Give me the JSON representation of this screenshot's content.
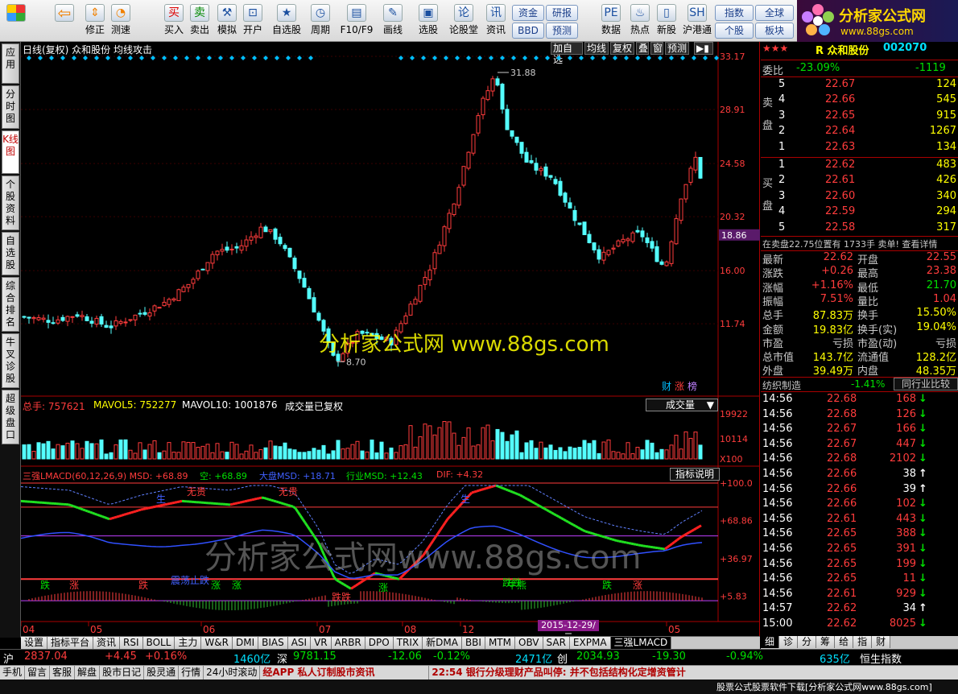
{
  "toolbar": {
    "buttons": [
      {
        "label": "",
        "icon": "windows-icon"
      },
      {
        "label": "",
        "icon": "back-arrow-icon"
      },
      {
        "label": "修正",
        "icon": "up-down-icon"
      },
      {
        "label": "测速",
        "icon": "speed-icon"
      },
      {
        "label": "买入",
        "icon": "buy-icon",
        "glyph": "买"
      },
      {
        "label": "卖出",
        "icon": "sell-icon",
        "glyph": "卖"
      },
      {
        "label": "模拟",
        "icon": "hammer-icon",
        "glyph": "⚒"
      },
      {
        "label": "开户",
        "icon": "lock-icon",
        "glyph": "⊡"
      },
      {
        "label": "自选股",
        "icon": "star-icon",
        "glyph": "★"
      },
      {
        "label": "周期",
        "icon": "clock-icon",
        "glyph": "◷"
      },
      {
        "label": "F10/F9",
        "icon": "f10-icon",
        "glyph": "▤"
      },
      {
        "label": "画线",
        "icon": "pen-icon",
        "glyph": "✎"
      },
      {
        "label": "选股",
        "icon": "select-icon",
        "glyph": "▣"
      },
      {
        "label": "论股堂",
        "icon": "forum-icon",
        "glyph": "论"
      },
      {
        "label": "资讯",
        "icon": "news-icon",
        "glyph": "讯"
      },
      {
        "label": "数据",
        "icon": "pe-icon",
        "glyph": "PE"
      },
      {
        "label": "热点",
        "icon": "hot-icon",
        "glyph": "♨"
      },
      {
        "label": "新股",
        "icon": "newstock-icon",
        "glyph": "▯"
      },
      {
        "label": "沪港通",
        "icon": "hk-icon",
        "glyph": "SH"
      }
    ],
    "small": [
      "资金",
      "研报",
      "BBD",
      "预测",
      "指数",
      "全球",
      "个股",
      "板块"
    ]
  },
  "logo": {
    "name": "分析家公式网",
    "url": "www.88gs.com"
  },
  "left_tabs": [
    "应用",
    "分时图",
    "K线图",
    "个股资料",
    "自选股",
    "综合排名",
    "牛叉诊股",
    "超级盘口"
  ],
  "chart": {
    "header": "日线(复权)  众和股份  均线攻击",
    "controls": [
      "加自选",
      "均线",
      "复权",
      "叠",
      "窗",
      "预测"
    ],
    "price_labels": [
      "33.17",
      "28.91",
      "24.58",
      "20.32",
      "16.00",
      "11.74"
    ],
    "cursor_price": "18.86",
    "hi_label": "31.88",
    "lo_label": "8.70",
    "watermark1": "分析家公式网  www.88gs.com",
    "watermark2": "分析家公式网www.88gs.com",
    "badges": [
      "财",
      "涨",
      "榜"
    ],
    "vol_header": {
      "a": "总手: 757621",
      "b": "MAVOL5: 752277",
      "c": "MAVOL10: 1001876",
      "d": "成交量已复权"
    },
    "vol_select": "成交量",
    "vol_labels": [
      "19922",
      "10114",
      "X100"
    ],
    "ind_header": {
      "a": "三强LMACD(60,12,26,9) MSD: +68.89",
      "b": "空: +68.89",
      "c": "大盘MSD: +18.71",
      "d": "行业MSD: +12.43",
      "e": "DIF: +4.32"
    },
    "ind_help": "指标说明",
    "ind_labels": [
      "+100.0",
      "+68.86",
      "+36.97",
      "+5.83"
    ],
    "ind_marks": [
      "跌",
      "涨",
      "跌",
      "涨",
      "震荡止跌",
      "涨",
      "牛熊",
      "无贵",
      "无贵",
      "生",
      "生",
      "跌跌",
      "涨",
      "跌跌",
      "跌",
      "涨"
    ],
    "xaxis": [
      "04",
      "05",
      "06",
      "07",
      "08",
      "12",
      "05"
    ],
    "cursor_date": "2015-12-29/二"
  },
  "rp": {
    "title": "R 众和股份",
    "code": "002070",
    "webi_label": "委比",
    "webi": "-23.09%",
    "webi_v": "-1119",
    "sell_label": "卖盘",
    "buy_label": "买盘",
    "asks": [
      {
        "n": "5",
        "p": "22.67",
        "v": "124"
      },
      {
        "n": "4",
        "p": "22.66",
        "v": "545"
      },
      {
        "n": "3",
        "p": "22.65",
        "v": "915"
      },
      {
        "n": "2",
        "p": "22.64",
        "v": "1267"
      },
      {
        "n": "1",
        "p": "22.63",
        "v": "134"
      }
    ],
    "bids": [
      {
        "n": "1",
        "p": "22.62",
        "v": "483"
      },
      {
        "n": "2",
        "p": "22.61",
        "v": "426"
      },
      {
        "n": "3",
        "p": "22.60",
        "v": "340"
      },
      {
        "n": "4",
        "p": "22.59",
        "v": "294"
      },
      {
        "n": "5",
        "p": "22.58",
        "v": "317"
      }
    ],
    "tape": "在卖盘22.75位置有 1733手 卖单! 查看详情",
    "stats": [
      [
        "最新",
        "22.62",
        "开盘",
        "22.55"
      ],
      [
        "涨跌",
        "+0.26",
        "最高",
        "23.38"
      ],
      [
        "涨幅",
        "+1.16%",
        "最低",
        "21.70"
      ],
      [
        "振幅",
        "7.51%",
        "量比",
        "1.04"
      ],
      [
        "总手",
        "87.83万",
        "换手",
        "15.50%"
      ],
      [
        "金额",
        "19.83亿",
        "换手(实)",
        "19.04%"
      ],
      [
        "市盈",
        "亏损",
        "市盈(动)",
        "亏损"
      ],
      [
        "总市值",
        "143.7亿",
        "流通值",
        "128.2亿"
      ],
      [
        "外盘",
        "39.49万",
        "内盘",
        "48.35万"
      ]
    ],
    "industry": "纺织制造",
    "industry_pct": "-1.41%",
    "compare": "同行业比较",
    "ticks": [
      [
        "14:56",
        "22.68",
        "168",
        "↓"
      ],
      [
        "14:56",
        "22.68",
        "126",
        "↓"
      ],
      [
        "14:56",
        "22.67",
        "166",
        "↓"
      ],
      [
        "14:56",
        "22.67",
        "447",
        "↓"
      ],
      [
        "14:56",
        "22.68",
        "2102",
        "↓"
      ],
      [
        "14:56",
        "22.66",
        "38",
        "↑"
      ],
      [
        "14:56",
        "22.66",
        "39",
        "↑"
      ],
      [
        "14:56",
        "22.66",
        "102",
        "↓"
      ],
      [
        "14:56",
        "22.61",
        "443",
        "↓"
      ],
      [
        "14:56",
        "22.65",
        "388",
        "↓"
      ],
      [
        "14:56",
        "22.65",
        "391",
        "↓"
      ],
      [
        "14:56",
        "22.65",
        "199",
        "↓"
      ],
      [
        "14:56",
        "22.65",
        "11",
        "↓"
      ],
      [
        "14:56",
        "22.61",
        "929",
        "↓"
      ],
      [
        "14:57",
        "22.62",
        "34",
        "↑"
      ],
      [
        "15:00",
        "22.62",
        "8025",
        "↓"
      ]
    ]
  },
  "bottom_tabs": [
    "设置",
    "指标平台",
    "资讯",
    "RSI",
    "BOLL",
    "主力",
    "W&R",
    "DMI",
    "BIAS",
    "ASI",
    "VR",
    "ARBR",
    "DPO",
    "TRIX",
    "新DMA",
    "BBI",
    "MTM",
    "OBV",
    "SAR",
    "EXPMA",
    "三强LMACD"
  ],
  "right_tabs": [
    "细",
    "诊",
    "分",
    "筹",
    "给",
    "指",
    "财"
  ],
  "index_bar": {
    "sh": "沪",
    "sh_val": "2837.04",
    "sh_chg": "+4.45",
    "sh_pct": "+0.16%",
    "sh_amt": "1460亿",
    "sz": "深",
    "sz_val": "9781.15",
    "sz_chg": "-12.06",
    "sz_pct": "-0.12%",
    "cy_amt": "2471亿",
    "cy": "创",
    "cy_val": "2034.93",
    "cy_chg": "-19.30",
    "cy_pct": "-0.94%",
    "hk_amt": "635亿",
    "hk": "恒生指数"
  },
  "status": {
    "items": [
      "手机",
      "留言",
      "客服",
      "解盘",
      "股市日记",
      "股灵通",
      "行情",
      "24小时滚动"
    ],
    "ticker1": "经APP 私人订制股市资讯",
    "ticker2": "22:54 银行分级理财产品叫停: 并不包括结构化定增资管计",
    "banner": "股票公式股票软件下载[分析家公式网www.88gs.com]"
  }
}
